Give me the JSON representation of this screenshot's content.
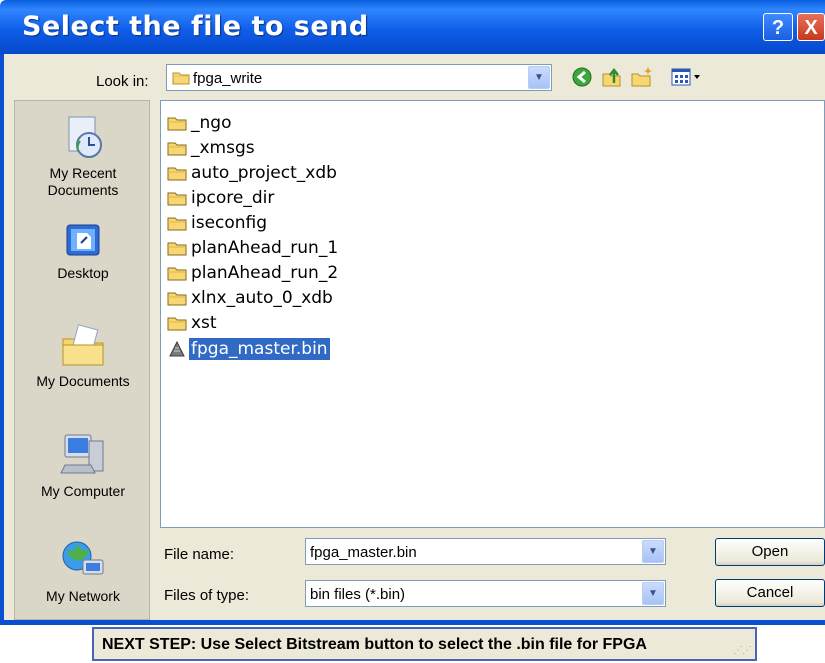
{
  "dialog": {
    "title": "Select the file to send",
    "help_symbol": "?",
    "close_symbol": "X"
  },
  "look_in": {
    "label": "Look in:",
    "value": "fpga_write"
  },
  "toolbar": {
    "icons": [
      "back-icon",
      "up-folder-icon",
      "new-folder-icon",
      "view-menu-icon"
    ]
  },
  "places": [
    {
      "label": "My Recent Documents",
      "line1": "My Recent",
      "line2": "Documents",
      "icon": "recent-documents-icon"
    },
    {
      "label": "Desktop",
      "line1": "Desktop",
      "line2": "",
      "icon": "desktop-icon"
    },
    {
      "label": "My Documents",
      "line1": "My Documents",
      "line2": "",
      "icon": "my-documents-icon"
    },
    {
      "label": "My Computer",
      "line1": "My Computer",
      "line2": "",
      "icon": "my-computer-icon"
    },
    {
      "label": "My Network",
      "line1": "My Network",
      "line2": "",
      "icon": "my-network-icon"
    }
  ],
  "files": [
    {
      "name": "_ngo",
      "type": "folder",
      "selected": false
    },
    {
      "name": "_xmsgs",
      "type": "folder",
      "selected": false
    },
    {
      "name": "auto_project_xdb",
      "type": "folder",
      "selected": false
    },
    {
      "name": "ipcore_dir",
      "type": "folder",
      "selected": false
    },
    {
      "name": "iseconfig",
      "type": "folder",
      "selected": false
    },
    {
      "name": "planAhead_run_1",
      "type": "folder",
      "selected": false
    },
    {
      "name": "planAhead_run_2",
      "type": "folder",
      "selected": false
    },
    {
      "name": "xlnx_auto_0_xdb",
      "type": "folder",
      "selected": false
    },
    {
      "name": "xst",
      "type": "folder",
      "selected": false
    },
    {
      "name": "fpga_master.bin",
      "type": "file",
      "selected": true
    }
  ],
  "file_name": {
    "label": "File name:",
    "value": "fpga_master.bin"
  },
  "file_type": {
    "label": "Files of type:",
    "value": "bin files (*.bin)"
  },
  "buttons": {
    "open": "Open",
    "cancel": "Cancel"
  },
  "status_bar": {
    "text": "NEXT STEP: Use Select Bitstream button to select the .bin file for FPGA"
  },
  "colors": {
    "title_bar": "#0a5fe0",
    "selection": "#316ac5",
    "dialog_bg": "#ece9d8"
  }
}
